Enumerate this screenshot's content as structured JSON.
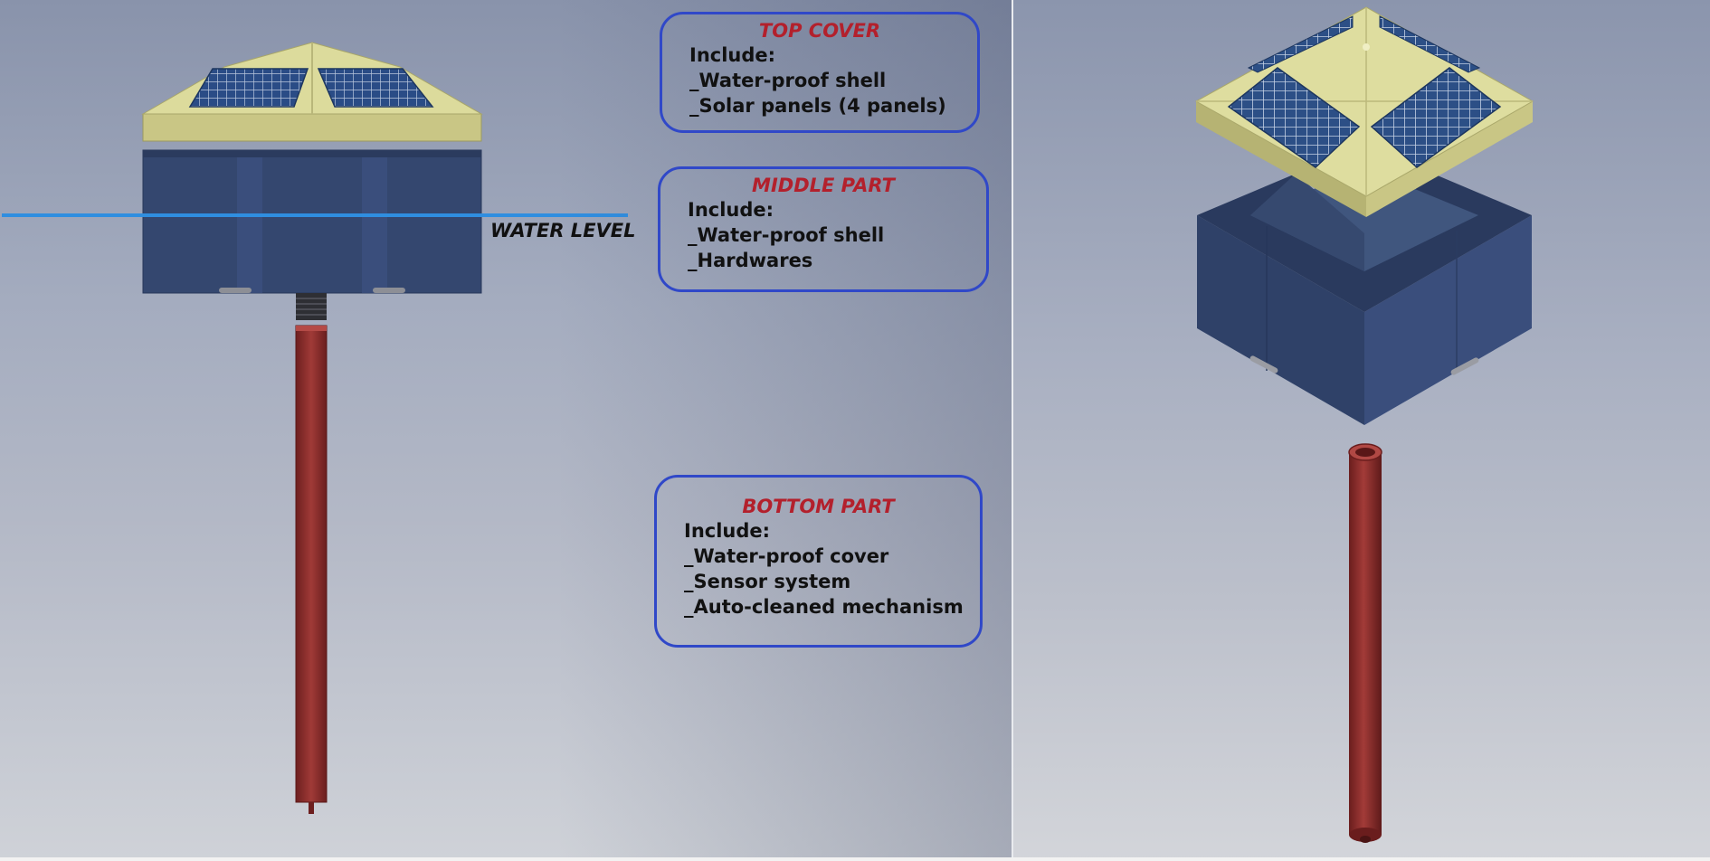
{
  "water_level_label": "WATER LEVEL",
  "callouts": {
    "top": {
      "title": "TOP COVER",
      "lines": [
        "Include:",
        "_Water-proof shell",
        "_Solar panels (4 panels)"
      ]
    },
    "middle": {
      "title": "MIDDLE PART",
      "lines": [
        "Include:",
        "_Water-proof shell",
        "_Hardwares"
      ]
    },
    "bottom": {
      "title": "BOTTOM PART",
      "lines": [
        "Include:",
        "_Water-proof cover",
        "_Sensor system",
        "_Auto-cleaned mechanism"
      ]
    }
  },
  "colors": {
    "callout_border": "#3048c8",
    "callout_title": "#b3202c",
    "water_line": "#2f8ee0",
    "cover": "#d6d596",
    "body_blue": "#34476f",
    "pipe_red": "#8a2a2a",
    "solar": "#2c4f86"
  }
}
